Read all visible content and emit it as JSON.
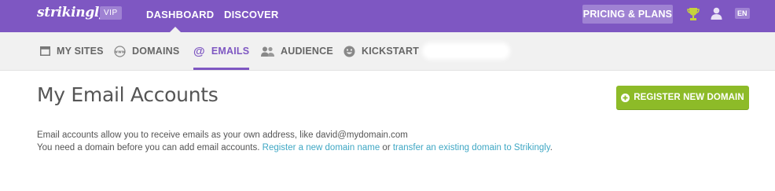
{
  "header": {
    "logo": "strikingly",
    "badge": "VIP",
    "nav": [
      "DASHBOARD",
      "DISCOVER"
    ],
    "pricing_label": "PRICING & PLANS",
    "lang": "EN",
    "icons": [
      "trophy-icon",
      "user-icon"
    ]
  },
  "tabs": [
    {
      "label": "MY SITES",
      "icon": "window-icon"
    },
    {
      "label": "DOMAINS",
      "icon": "www-icon"
    },
    {
      "label": "EMAILS",
      "icon": "at-icon",
      "active": true
    },
    {
      "label": "AUDIENCE",
      "icon": "people-icon"
    },
    {
      "label": "KICKSTART",
      "icon": "smiley-icon"
    }
  ],
  "main": {
    "title": "My Email Accounts",
    "register_button": "REGISTER NEW DOMAIN",
    "line1": "Email accounts allow you to receive emails as your own address, like david@mydomain.com",
    "line2_prefix": "You need a domain before you can add email accounts. ",
    "line2_link1": "Register a new domain name",
    "line2_mid": " or ",
    "line2_link2": "transfer an existing domain to Strikingly",
    "line2_suffix": "."
  },
  "colors": {
    "brand_purple": "#7e57c2",
    "button_green": "#8dbb28",
    "link_blue": "#3fa7c4"
  }
}
